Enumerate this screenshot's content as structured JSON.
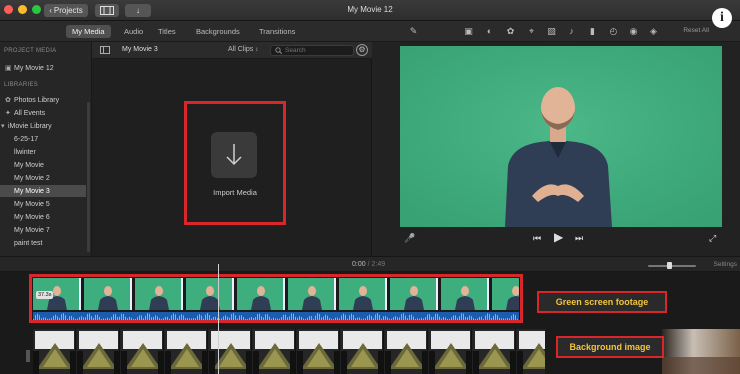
{
  "window": {
    "title": "My Movie 12",
    "projects_label": "Projects",
    "info_icon": "i"
  },
  "colors": {
    "accent_red": "#d8262a",
    "callout_text": "#f3c53b",
    "green_screen": "#3fae7e"
  },
  "tabs": [
    {
      "label": "My Media",
      "active": true
    },
    {
      "label": "Audio"
    },
    {
      "label": "Titles"
    },
    {
      "label": "Backgrounds"
    },
    {
      "label": "Transitions"
    }
  ],
  "toolbar": {
    "reset_all": "Reset All",
    "icons": [
      "magic-wand-icon",
      "overlay-icon",
      "color-balance-icon",
      "color-palette-icon",
      "crop-icon",
      "stabilize-icon",
      "volume-icon",
      "equalizer-icon",
      "speed-icon",
      "noise-reduction-icon",
      "clip-filter-icon"
    ]
  },
  "sidebar": {
    "project_media_header": "PROJECT MEDIA",
    "project_item": "My Movie 12",
    "libraries_header": "LIBRARIES",
    "photos_library": "Photos Library",
    "all_events": "All Events",
    "imovie_library": "iMovie Library",
    "events": [
      {
        "label": "6-25-17"
      },
      {
        "label": "llwinter"
      },
      {
        "label": "My Movie"
      },
      {
        "label": "My Movie 2"
      },
      {
        "label": "My Movie 3",
        "selected": true
      },
      {
        "label": "My Movie 5"
      },
      {
        "label": "My Movie 6"
      },
      {
        "label": "My Movie 7"
      },
      {
        "label": "paint test"
      }
    ]
  },
  "browser": {
    "event_name": "My Movie 3",
    "filter_label": "All Clips",
    "search_placeholder": "Search",
    "import_label": "Import Media"
  },
  "timeline": {
    "current_time": "0:00",
    "separator": "/",
    "total_time": "2:49",
    "settings_label": "Settings",
    "zoom_level": 0.45,
    "clip_duration": "37.3s",
    "callout_green": "Green screen footage",
    "callout_background": "Background image"
  }
}
